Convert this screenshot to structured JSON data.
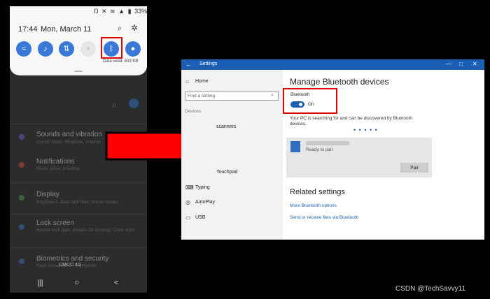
{
  "phone": {
    "status": {
      "icons": [
        "nfc-icon",
        "mute-icon",
        "wifi-icon",
        "signal-icon",
        "battery-icon"
      ],
      "battery": "33%"
    },
    "qs": {
      "time": "17:44",
      "date": "Mon, March 11",
      "search_icon": "search-icon",
      "settings_icon": "gear-icon",
      "tiles": [
        {
          "name": "wifi",
          "glyph": "≈",
          "on": true
        },
        {
          "name": "sound",
          "glyph": "♪",
          "on": true
        },
        {
          "name": "mobile-data",
          "glyph": "⇅",
          "on": true
        },
        {
          "name": "flashlight",
          "glyph": "♀",
          "on": false
        },
        {
          "name": "bluetooth",
          "glyph": "ᛒ",
          "on": true
        },
        {
          "name": "location",
          "glyph": "●",
          "on": true
        }
      ],
      "data_used": "Data used: 603 KB"
    },
    "settings_list": [
      {
        "title": "Sounds and vibration",
        "subtitle": "Sound mode, Ringtone, Volume",
        "color": "#7b5bd6"
      },
      {
        "title": "Notifications",
        "subtitle": "Block, allow, prioritize",
        "color": "#e0533f"
      },
      {
        "title": "Display",
        "subtitle": "Brightness, Blue light filter, Home screen",
        "color": "#4aa84a"
      },
      {
        "title": "Lock screen",
        "subtitle": "Screen lock type, Always On Display, Clock style",
        "color": "#3a78d8"
      },
      {
        "title": "Biometrics and security",
        "subtitle": "Face recognition, Fingerprints",
        "color": "#3a78d8"
      }
    ],
    "carrier": "CMCC 4G",
    "nav": {
      "recent": "|||",
      "home": "○",
      "back": "<"
    }
  },
  "windows": {
    "title": "Settings",
    "back_glyph": "←",
    "controls": {
      "minimize": "—",
      "maximize": "□",
      "close": "✕"
    },
    "sidebar": {
      "home": "Home",
      "find_placeholder": "Find a setting",
      "section": "Devices",
      "items": [
        "scanners",
        "Touchpad",
        "Typing",
        "AutoPlay",
        "USB"
      ]
    },
    "main": {
      "title": "Manage Bluetooth devices",
      "bluetooth_label": "Bluetooth",
      "toggle_state": "On",
      "search_message": "Your PC is searching for and can be discovered by Bluetooth devices.",
      "searching_dots": "• • • • •",
      "device_status": "Ready to pair",
      "pair_button": "Pair",
      "related_title": "Related settings",
      "links": [
        "More Bluetooth options",
        "Send or receive files via Bluetooth"
      ]
    }
  },
  "colors": {
    "accent": "#1a5fb4",
    "highlight": "#e00000",
    "arrow": "#ff0000"
  },
  "watermark": "CSDN @TechSavvy11"
}
